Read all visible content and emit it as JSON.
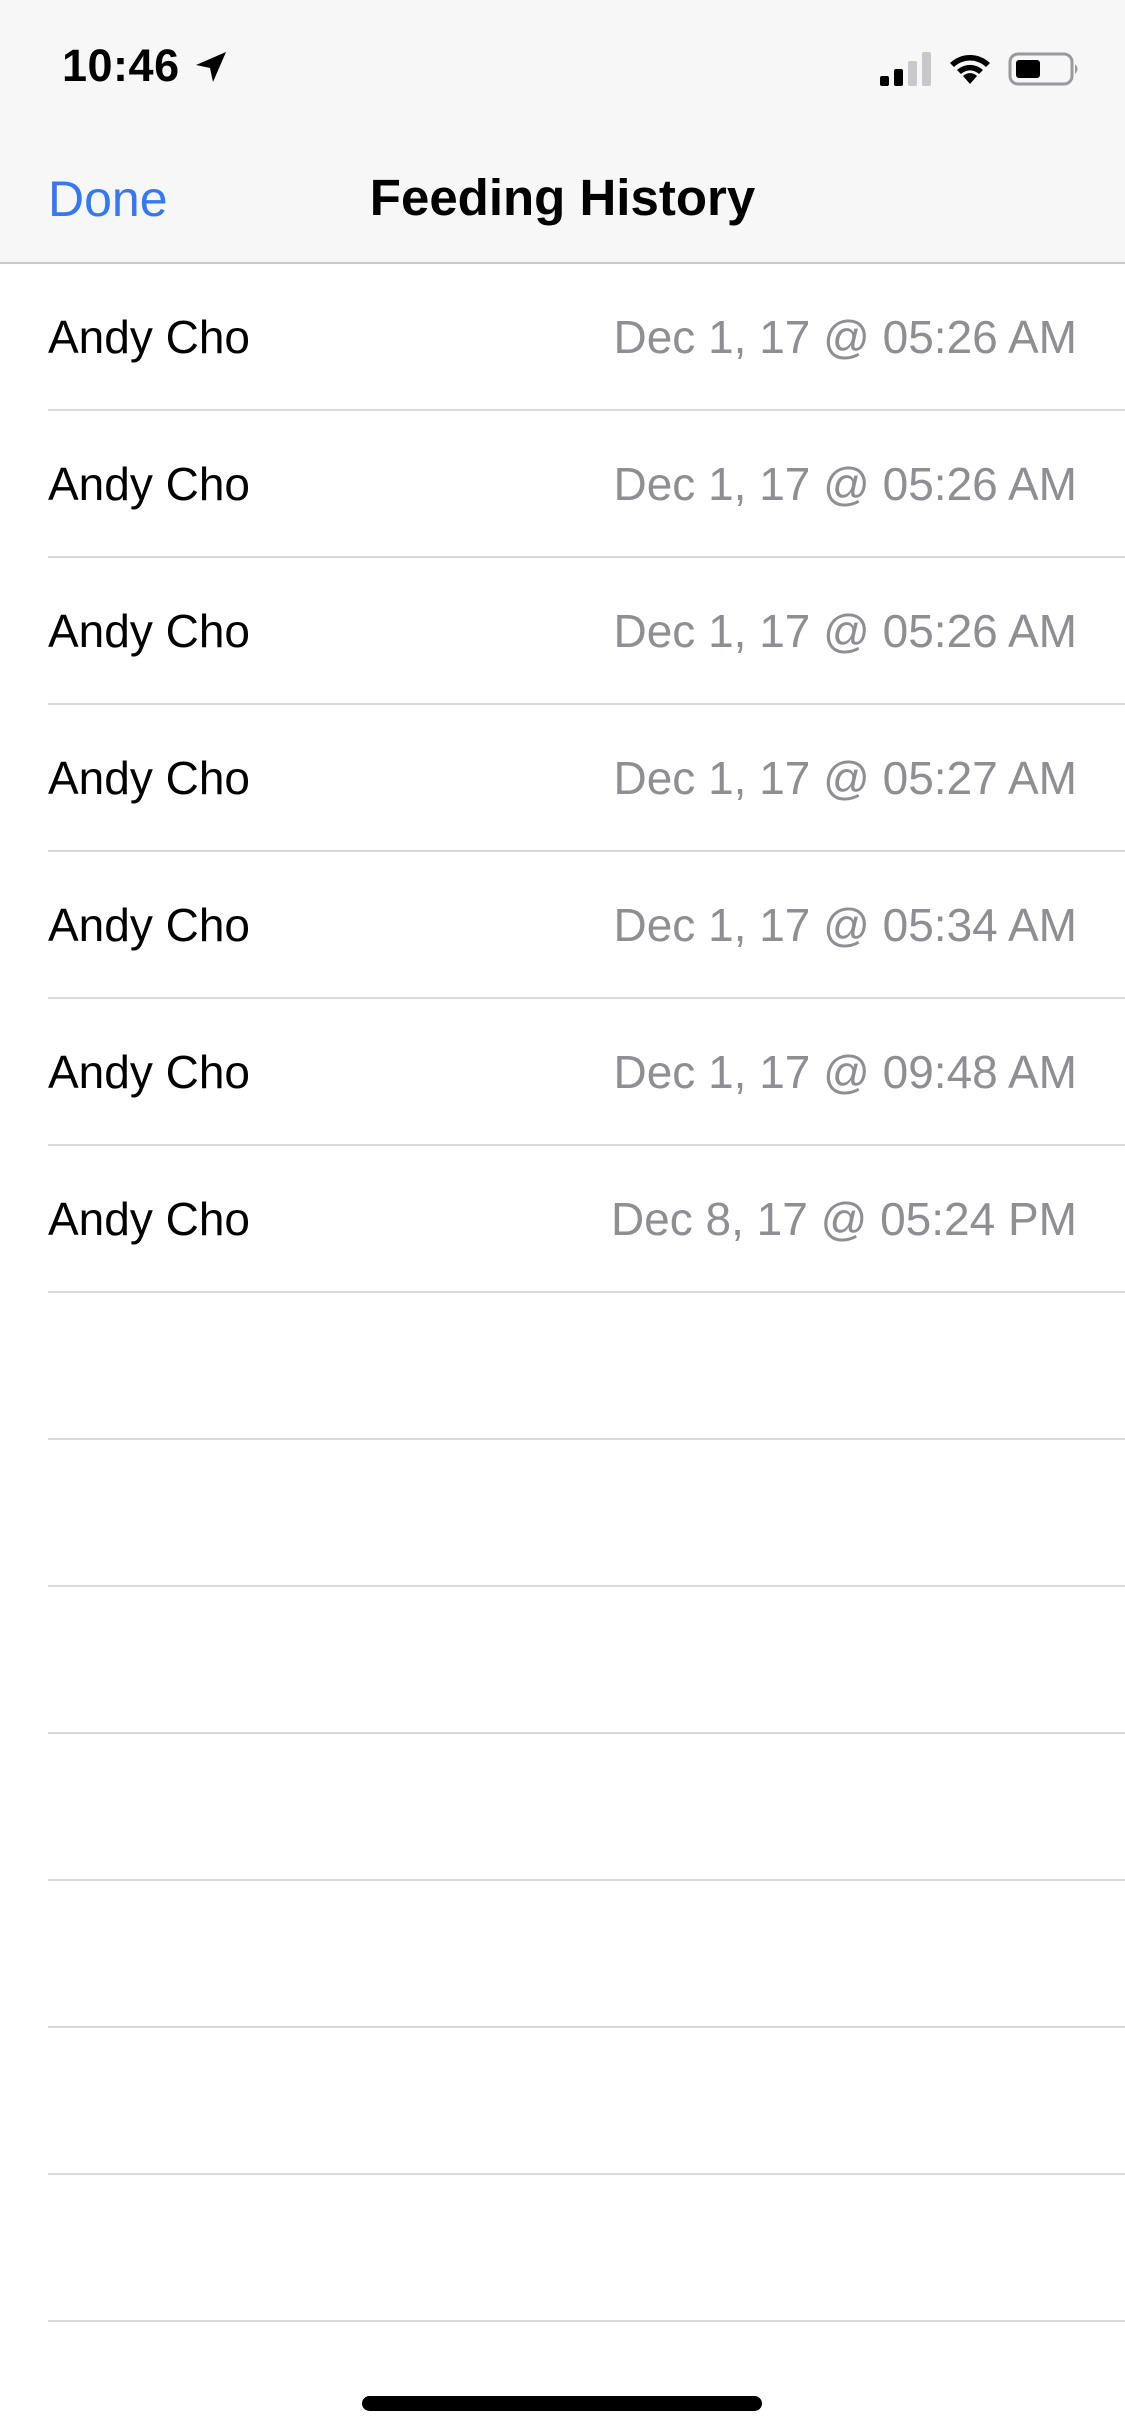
{
  "status_bar": {
    "time": "10:46",
    "icons": [
      "location-arrow-icon",
      "cellular-signal-icon",
      "wifi-icon",
      "battery-icon"
    ]
  },
  "nav": {
    "done_label": "Done",
    "title": "Feeding History"
  },
  "colors": {
    "accent": "#3478f6",
    "detail_text": "#8e8e93",
    "nav_background": "#f7f7f7",
    "separator": "#d9d9dc"
  },
  "history": {
    "rows": [
      {
        "name": "Andy Cho",
        "date": "Dec 1, 17 @ 05:26 AM"
      },
      {
        "name": "Andy Cho",
        "date": "Dec 1, 17 @ 05:26 AM"
      },
      {
        "name": "Andy Cho",
        "date": "Dec 1, 17 @ 05:26 AM"
      },
      {
        "name": "Andy Cho",
        "date": "Dec 1, 17 @ 05:27 AM"
      },
      {
        "name": "Andy Cho",
        "date": "Dec 1, 17 @ 05:34 AM"
      },
      {
        "name": "Andy Cho",
        "date": "Dec 1, 17 @ 09:48 AM"
      },
      {
        "name": "Andy Cho",
        "date": "Dec 8, 17 @ 05:24 PM"
      }
    ]
  }
}
